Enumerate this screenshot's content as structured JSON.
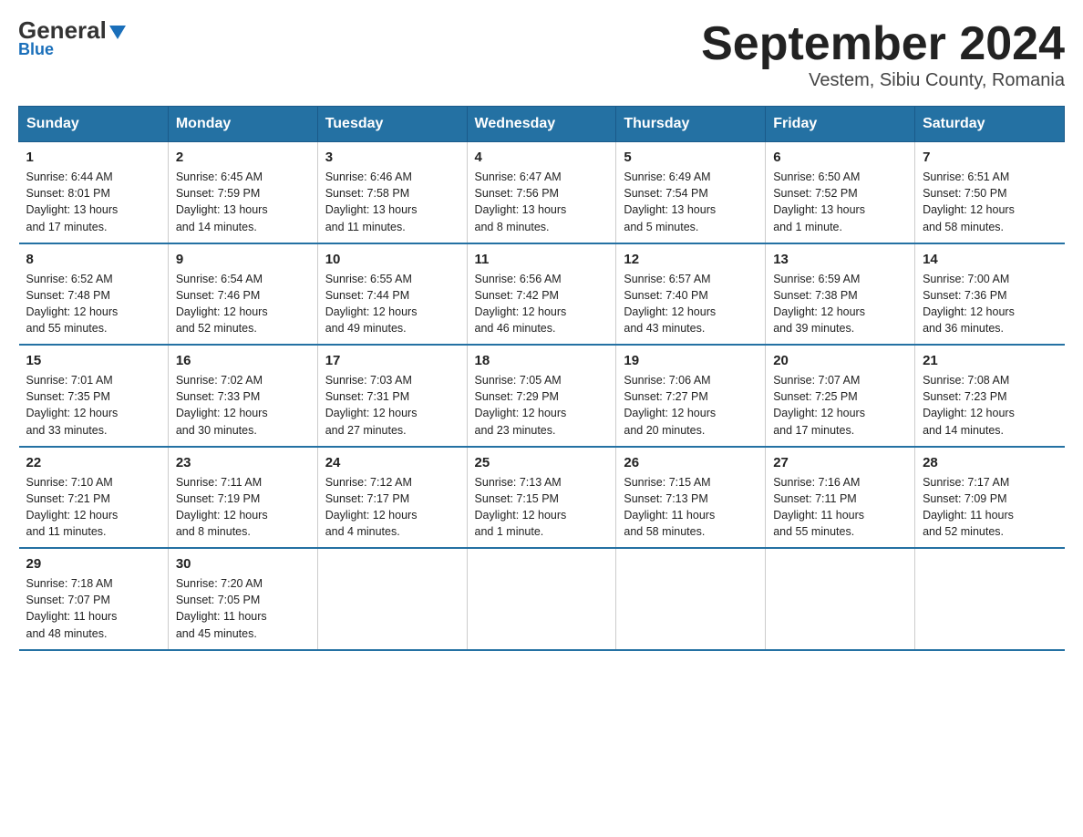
{
  "header": {
    "logo_top": "General",
    "logo_bottom": "Blue",
    "title": "September 2024",
    "subtitle": "Vestem, Sibiu County, Romania"
  },
  "days_of_week": [
    "Sunday",
    "Monday",
    "Tuesday",
    "Wednesday",
    "Thursday",
    "Friday",
    "Saturday"
  ],
  "weeks": [
    [
      {
        "day": "1",
        "info": "Sunrise: 6:44 AM\nSunset: 8:01 PM\nDaylight: 13 hours\nand 17 minutes."
      },
      {
        "day": "2",
        "info": "Sunrise: 6:45 AM\nSunset: 7:59 PM\nDaylight: 13 hours\nand 14 minutes."
      },
      {
        "day": "3",
        "info": "Sunrise: 6:46 AM\nSunset: 7:58 PM\nDaylight: 13 hours\nand 11 minutes."
      },
      {
        "day": "4",
        "info": "Sunrise: 6:47 AM\nSunset: 7:56 PM\nDaylight: 13 hours\nand 8 minutes."
      },
      {
        "day": "5",
        "info": "Sunrise: 6:49 AM\nSunset: 7:54 PM\nDaylight: 13 hours\nand 5 minutes."
      },
      {
        "day": "6",
        "info": "Sunrise: 6:50 AM\nSunset: 7:52 PM\nDaylight: 13 hours\nand 1 minute."
      },
      {
        "day": "7",
        "info": "Sunrise: 6:51 AM\nSunset: 7:50 PM\nDaylight: 12 hours\nand 58 minutes."
      }
    ],
    [
      {
        "day": "8",
        "info": "Sunrise: 6:52 AM\nSunset: 7:48 PM\nDaylight: 12 hours\nand 55 minutes."
      },
      {
        "day": "9",
        "info": "Sunrise: 6:54 AM\nSunset: 7:46 PM\nDaylight: 12 hours\nand 52 minutes."
      },
      {
        "day": "10",
        "info": "Sunrise: 6:55 AM\nSunset: 7:44 PM\nDaylight: 12 hours\nand 49 minutes."
      },
      {
        "day": "11",
        "info": "Sunrise: 6:56 AM\nSunset: 7:42 PM\nDaylight: 12 hours\nand 46 minutes."
      },
      {
        "day": "12",
        "info": "Sunrise: 6:57 AM\nSunset: 7:40 PM\nDaylight: 12 hours\nand 43 minutes."
      },
      {
        "day": "13",
        "info": "Sunrise: 6:59 AM\nSunset: 7:38 PM\nDaylight: 12 hours\nand 39 minutes."
      },
      {
        "day": "14",
        "info": "Sunrise: 7:00 AM\nSunset: 7:36 PM\nDaylight: 12 hours\nand 36 minutes."
      }
    ],
    [
      {
        "day": "15",
        "info": "Sunrise: 7:01 AM\nSunset: 7:35 PM\nDaylight: 12 hours\nand 33 minutes."
      },
      {
        "day": "16",
        "info": "Sunrise: 7:02 AM\nSunset: 7:33 PM\nDaylight: 12 hours\nand 30 minutes."
      },
      {
        "day": "17",
        "info": "Sunrise: 7:03 AM\nSunset: 7:31 PM\nDaylight: 12 hours\nand 27 minutes."
      },
      {
        "day": "18",
        "info": "Sunrise: 7:05 AM\nSunset: 7:29 PM\nDaylight: 12 hours\nand 23 minutes."
      },
      {
        "day": "19",
        "info": "Sunrise: 7:06 AM\nSunset: 7:27 PM\nDaylight: 12 hours\nand 20 minutes."
      },
      {
        "day": "20",
        "info": "Sunrise: 7:07 AM\nSunset: 7:25 PM\nDaylight: 12 hours\nand 17 minutes."
      },
      {
        "day": "21",
        "info": "Sunrise: 7:08 AM\nSunset: 7:23 PM\nDaylight: 12 hours\nand 14 minutes."
      }
    ],
    [
      {
        "day": "22",
        "info": "Sunrise: 7:10 AM\nSunset: 7:21 PM\nDaylight: 12 hours\nand 11 minutes."
      },
      {
        "day": "23",
        "info": "Sunrise: 7:11 AM\nSunset: 7:19 PM\nDaylight: 12 hours\nand 8 minutes."
      },
      {
        "day": "24",
        "info": "Sunrise: 7:12 AM\nSunset: 7:17 PM\nDaylight: 12 hours\nand 4 minutes."
      },
      {
        "day": "25",
        "info": "Sunrise: 7:13 AM\nSunset: 7:15 PM\nDaylight: 12 hours\nand 1 minute."
      },
      {
        "day": "26",
        "info": "Sunrise: 7:15 AM\nSunset: 7:13 PM\nDaylight: 11 hours\nand 58 minutes."
      },
      {
        "day": "27",
        "info": "Sunrise: 7:16 AM\nSunset: 7:11 PM\nDaylight: 11 hours\nand 55 minutes."
      },
      {
        "day": "28",
        "info": "Sunrise: 7:17 AM\nSunset: 7:09 PM\nDaylight: 11 hours\nand 52 minutes."
      }
    ],
    [
      {
        "day": "29",
        "info": "Sunrise: 7:18 AM\nSunset: 7:07 PM\nDaylight: 11 hours\nand 48 minutes."
      },
      {
        "day": "30",
        "info": "Sunrise: 7:20 AM\nSunset: 7:05 PM\nDaylight: 11 hours\nand 45 minutes."
      },
      {
        "day": "",
        "info": ""
      },
      {
        "day": "",
        "info": ""
      },
      {
        "day": "",
        "info": ""
      },
      {
        "day": "",
        "info": ""
      },
      {
        "day": "",
        "info": ""
      }
    ]
  ]
}
